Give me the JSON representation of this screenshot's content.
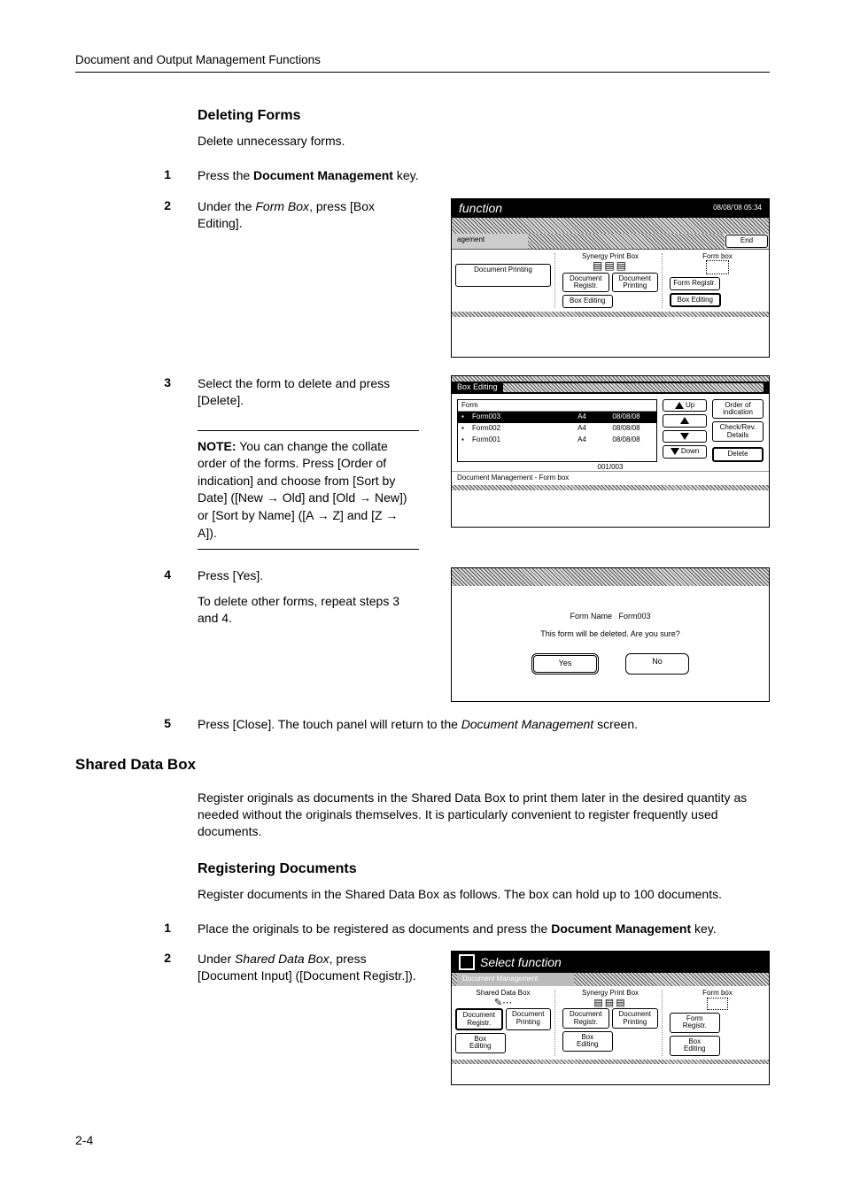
{
  "running_head": "Document and Output Management Functions",
  "page_number": "2-4",
  "section1": {
    "title": "Deleting Forms",
    "intro": "Delete unnecessary forms.",
    "step1": {
      "num": "1",
      "text_a": "Press the ",
      "bold": "Document Management",
      "text_b": " key."
    },
    "step2": {
      "num": "2",
      "text_a": "Under the ",
      "italic": "Form Box",
      "text_b": ", press [Box Editing]."
    },
    "step3": {
      "num": "3",
      "text": "Select the form to delete and press [Delete].",
      "note_label": "NOTE:",
      "note_body": " You can change the collate order of the forms. Press [Order of indication] and choose from [Sort by Date] ([New → Old] and [Old → New]) or [Sort by Name] ([A → Z] and [Z → A])."
    },
    "step4": {
      "num": "4",
      "line1": "Press [Yes].",
      "line2": "To delete other forms, repeat steps 3 and 4."
    },
    "step5": {
      "num": "5",
      "text_a": "Press [Close]. The touch panel will return to the ",
      "italic": "Document Management",
      "text_b": " screen."
    }
  },
  "section2": {
    "title": "Shared Data Box",
    "intro": "Register originals as documents in the Shared Data Box to print them later in the desired quantity as needed without the originals themselves. It is particularly convenient to register frequently used documents.",
    "sub_title": "Registering Documents",
    "sub_intro": "Register documents in the Shared Data Box as follows. The box can hold up to 100 documents.",
    "step1": {
      "num": "1",
      "text_a": "Place the originals to be registered as documents and press the ",
      "bold": "Document Management",
      "text_b": " key."
    },
    "step2": {
      "num": "2",
      "text_a": "Under ",
      "italic": "Shared Data Box",
      "text_b": ", press [Document Input] ([Document Registr.])."
    }
  },
  "screen1": {
    "title": "function",
    "timestamp": "08/08/'08 05:34",
    "tab": "agement",
    "end": "End",
    "cols": {
      "synergy": "Synergy Print Box",
      "form": "Form box"
    },
    "btns": {
      "doc_print": "Document\nPrinting",
      "doc_reg": "Document\nRegistr.",
      "box_edit": "Box\nEditing",
      "form_reg": "Form\nRegistr."
    }
  },
  "screen2": {
    "title": "Box Editing",
    "header": "Form",
    "rows": [
      {
        "name": "Form003",
        "size": "A4",
        "date": "08/08/08",
        "sel": true
      },
      {
        "name": "Form002",
        "size": "A4",
        "date": "08/08/08",
        "sel": false
      },
      {
        "name": "Form001",
        "size": "A4",
        "date": "08/08/08",
        "sel": false
      }
    ],
    "counter": "001/003",
    "up": "Up",
    "down": "Down",
    "order": "Order of\nindication",
    "check": "Check/Rev.\nDetails",
    "delete": "Delete",
    "breadcrumb": "Document Management   -    Form box"
  },
  "screen3": {
    "label": "Form Name",
    "value": "Form003",
    "msg": "This form will be deleted. Are you sure?",
    "yes": "Yes",
    "no": "No"
  },
  "screen4": {
    "title": "Select function",
    "tab": "Document Management",
    "cols": {
      "shared": "Shared Data Box",
      "synergy": "Synergy Print Box",
      "form": "Form box"
    },
    "btns": {
      "doc_reg": "Document\nRegistr.",
      "doc_print": "Document\nPrinting",
      "box_edit": "Box\nEditing",
      "form_reg": "Form\nRegistr."
    }
  }
}
